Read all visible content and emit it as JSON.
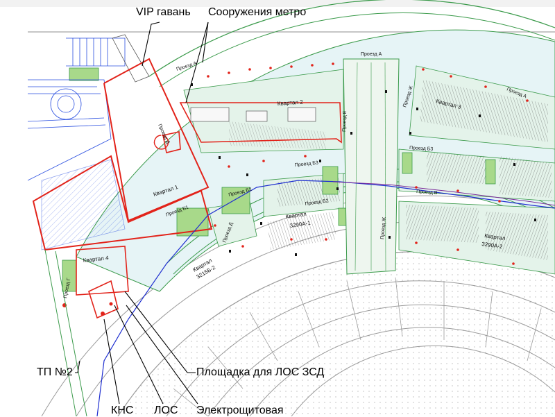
{
  "callouts": {
    "vip_harbor": "VIP гавань",
    "metro": "Сооружения метро",
    "tp2": "ТП №2",
    "los_site": "Площадка для ЛОС ЗСД",
    "kns": "КНС",
    "los": "ЛОС",
    "electro": "Электрощитовая"
  },
  "map_labels": {
    "kvartal_1": "Квартал 1",
    "kvartal_2": "Квартал 2",
    "kvartal_3": "Квартал 3",
    "kvartal_4": "Квартал 4",
    "kvartal_3290a1_a": "Квартал",
    "kvartal_3290a1_b": "3290А-1",
    "kvartal_3290a2_a": "Квартал",
    "kvartal_3290a2_b": "3290А-2",
    "kvartal_3215b2_a": "Квартал",
    "kvartal_3215b2_b": "3215Б-2",
    "proezd_a": "Проезд А",
    "proezd_a2": "Проезд А",
    "proezd_a3": "Проезд А",
    "proezd_b1": "Проезд Б1",
    "proezd_b2": "Проезд Б2",
    "proezd_b2b": "Проезд Б2",
    "proezd_b3": "Проезд Б3",
    "proezd_b3b": "Проезд Б3",
    "proezd_v": "Проезд В",
    "proezd_g": "Проезд Г",
    "proezd_d": "Проезд Д",
    "proezd_d2": "Проезд Д",
    "proezd_e": "Проезд Е",
    "proezd_zh": "Проезд Ж",
    "proezd_zh2": "Проезд Ж"
  },
  "colors": {
    "boundary_red": "#e2231a",
    "road_green": "#3a9a4a",
    "block_fill": "#e4f3ea",
    "green_zone": "#a8d98a",
    "stadium_gray": "#8c8c8c",
    "utility_blue": "#1f2fd0",
    "water_blue": "#2a4fe0",
    "purple_line": "#7a2a9a"
  }
}
